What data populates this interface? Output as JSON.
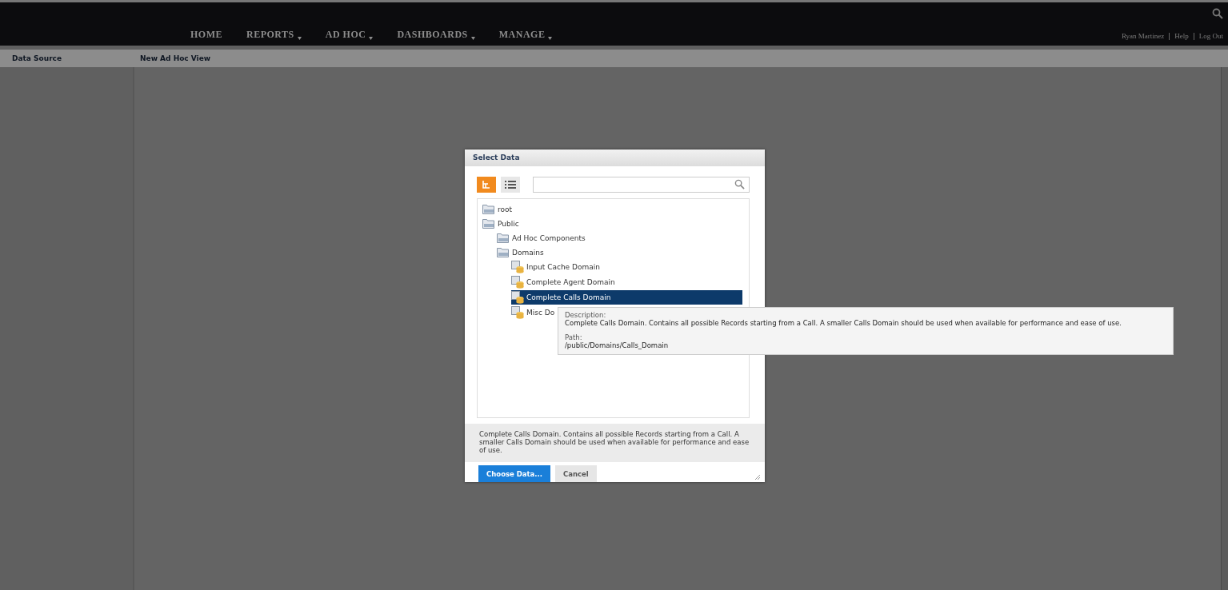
{
  "nav": [
    {
      "label": "HOME",
      "dropdown": false
    },
    {
      "label": "REPORTS",
      "dropdown": true
    },
    {
      "label": "AD HOC",
      "dropdown": true
    },
    {
      "label": "DASHBOARDS",
      "dropdown": true
    },
    {
      "label": "MANAGE",
      "dropdown": true
    }
  ],
  "user_links": [
    "Ryan Martinez",
    "Help",
    "Log Out"
  ],
  "subheader": {
    "data_source": "Data Source",
    "view_title": "New Ad Hoc View"
  },
  "dialog": {
    "title": "Select Data",
    "view_modes": [
      {
        "kind": "tree",
        "selected": true
      },
      {
        "kind": "list",
        "selected": false
      }
    ],
    "tree": [
      {
        "label": "root",
        "kind": "folder",
        "selected": false
      },
      {
        "label": "Public",
        "kind": "folder",
        "selected": false,
        "children": [
          {
            "label": "Ad Hoc Components",
            "kind": "folder",
            "selected": false
          },
          {
            "label": "Domains",
            "kind": "folder",
            "selected": false,
            "children": [
              {
                "label": "Input Cache Domain",
                "kind": "domain",
                "selected": false
              },
              {
                "label": "Complete Agent Domain",
                "kind": "domain",
                "selected": false
              },
              {
                "label": "Complete Calls Domain",
                "kind": "domain",
                "selected": true
              },
              {
                "label": "Misc Do",
                "kind": "domain",
                "selected": false
              }
            ]
          }
        ]
      }
    ],
    "description": "Complete Calls Domain. Contains all possible Records starting from a Call. A smaller Calls Domain should be used when available for performance and ease of use.",
    "buttons": [
      {
        "label": "Choose Data...",
        "kind": "primary"
      },
      {
        "label": "Cancel",
        "kind": "secondary"
      }
    ]
  },
  "tooltip": {
    "description_label": "Description:",
    "description": "Complete Calls Domain. Contains all possible Records starting from a Call. A smaller Calls Domain should be used when available for performance and ease of use.",
    "path_label": "Path:",
    "path": "/public/Domains/Calls_Domain"
  }
}
